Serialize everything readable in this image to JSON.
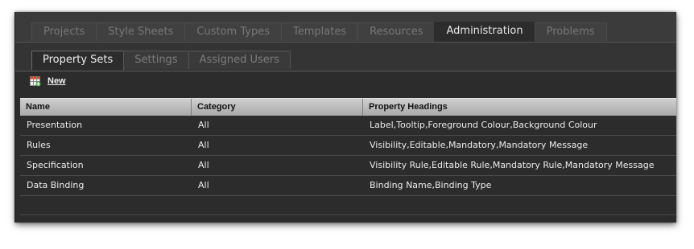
{
  "top_tabs": [
    {
      "label": "Projects",
      "active": false
    },
    {
      "label": "Style Sheets",
      "active": false
    },
    {
      "label": "Custom Types",
      "active": false
    },
    {
      "label": "Templates",
      "active": false
    },
    {
      "label": "Resources",
      "active": false
    },
    {
      "label": "Administration",
      "active": true
    },
    {
      "label": "Problems",
      "active": false
    }
  ],
  "sub_tabs": [
    {
      "label": "Property Sets",
      "active": true
    },
    {
      "label": "Settings",
      "active": false
    },
    {
      "label": "Assigned Users",
      "active": false
    }
  ],
  "toolbar": {
    "new_label": "New",
    "new_icon": "new-grid-icon"
  },
  "table": {
    "columns": [
      "Name",
      "Category",
      "Property Headings"
    ],
    "rows": [
      [
        "Presentation",
        "All",
        "Label,Tooltip,Foreground Colour,Background Colour"
      ],
      [
        "Rules",
        "All",
        "Visibility,Editable,Mandatory,Mandatory Message"
      ],
      [
        "Specification",
        "All",
        "Visibility Rule,Editable Rule,Mandatory Rule,Mandatory Message"
      ],
      [
        "Data Binding",
        "All",
        "Binding Name,Binding Type"
      ]
    ]
  },
  "colors": {
    "background": "#2c2c2c",
    "header": "#bdbdbd",
    "text": "#ececec"
  }
}
